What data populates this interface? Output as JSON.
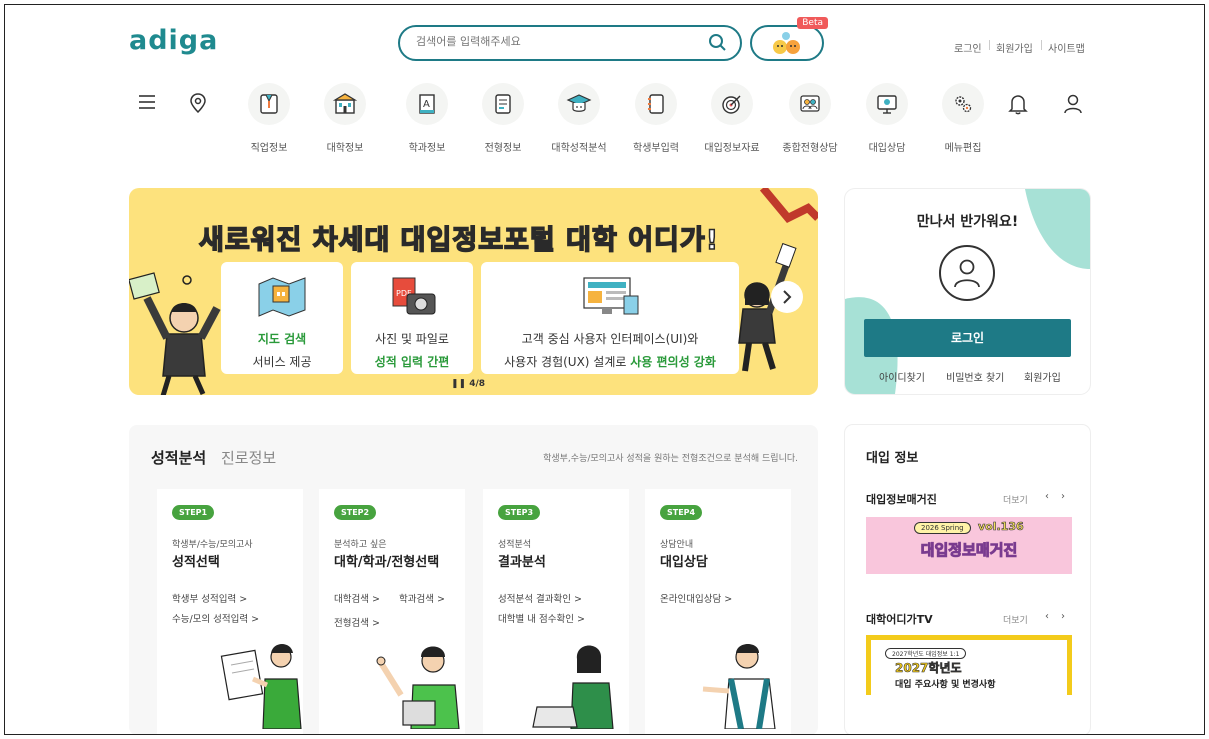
{
  "header": {
    "logo": "adiga",
    "search_placeholder": "검색어를 입력해주세요",
    "beta_label": "Beta",
    "util_links": [
      "로그인",
      "회원가입",
      "사이트맵"
    ]
  },
  "nav": {
    "categories": [
      {
        "label": "직업정보",
        "icon": "job-icon"
      },
      {
        "label": "대학정보",
        "icon": "university-icon"
      },
      {
        "label": "학과정보",
        "icon": "department-icon"
      },
      {
        "label": "전형정보",
        "icon": "admission-doc-icon"
      },
      {
        "label": "대학성적분석",
        "icon": "grad-cap-icon"
      },
      {
        "label": "학생부입력",
        "icon": "record-book-icon"
      },
      {
        "label": "대입정보자료",
        "icon": "target-icon"
      },
      {
        "label": "종합전형상담",
        "icon": "consult-people-icon"
      },
      {
        "label": "대입상담",
        "icon": "monitor-consult-icon"
      },
      {
        "label": "메뉴편집",
        "icon": "settings-icon"
      }
    ]
  },
  "banner": {
    "title": "새로워진 차세대 대입정보포털 대학 어디가!",
    "cards": [
      {
        "line1": "지도 검색",
        "line2": "서비스 제공"
      },
      {
        "line1": "사진 및 파일로",
        "line2": "성적 입력 간편"
      },
      {
        "line1": "고객 중심 사용자 인터페이스(UI)와",
        "line2a": "사용자 경험(UX) 설계로 ",
        "line2b": "사용 편의성 강화"
      }
    ],
    "pager": "4/8"
  },
  "login": {
    "greeting": "만나서 반가워요!",
    "button": "로그인",
    "links": [
      "아이디찾기",
      "비밀번호 찾기",
      "회원가입"
    ]
  },
  "analysis": {
    "tab_active": "성적분석",
    "tab_inactive": "진로정보",
    "description": "학생부,수능/모의고사 성적을 원하는 전형조건으로 분석해 드립니다.",
    "steps": [
      {
        "badge": "STEP1",
        "sub": "학생부/수능/모의고사",
        "title": "성적선택",
        "links": [
          "학생부 성적입력 >",
          "수능/모의 성적입력 >"
        ]
      },
      {
        "badge": "STEP2",
        "sub": "분석하고 싶은",
        "title": "대학/학과/전형선택",
        "links": [
          "대학검색 >",
          "학과검색 >",
          "전형검색 >"
        ]
      },
      {
        "badge": "STEP3",
        "sub": "성적분석",
        "title": "결과분석",
        "links": [
          "성적분석 결과확인 >",
          "대학별 내 점수확인 >"
        ]
      },
      {
        "badge": "STEP4",
        "sub": "상담안내",
        "title": "대입상담",
        "links": [
          "온라인대입상담 >"
        ]
      }
    ]
  },
  "info": {
    "title": "대입 정보",
    "magazine_title": "대입정보매거진",
    "magazine_more": "더보기",
    "magazine_tag": "2026 Spring",
    "magazine_vol": "vol.136",
    "magazine_banner": "대입정보매거진",
    "tv_title": "대학어디가TV",
    "tv_more": "더보기",
    "tv_tag": "2027학년도 대입정보 1:1",
    "tv_year": "2027학년도",
    "tv_caption": "대입 주요사항 및 변경사항"
  },
  "colors": {
    "brand_teal": "#1e7a86",
    "banner_yellow": "#fde27d",
    "step_green": "#47a33f",
    "magazine_pink": "#f9c6dc"
  }
}
